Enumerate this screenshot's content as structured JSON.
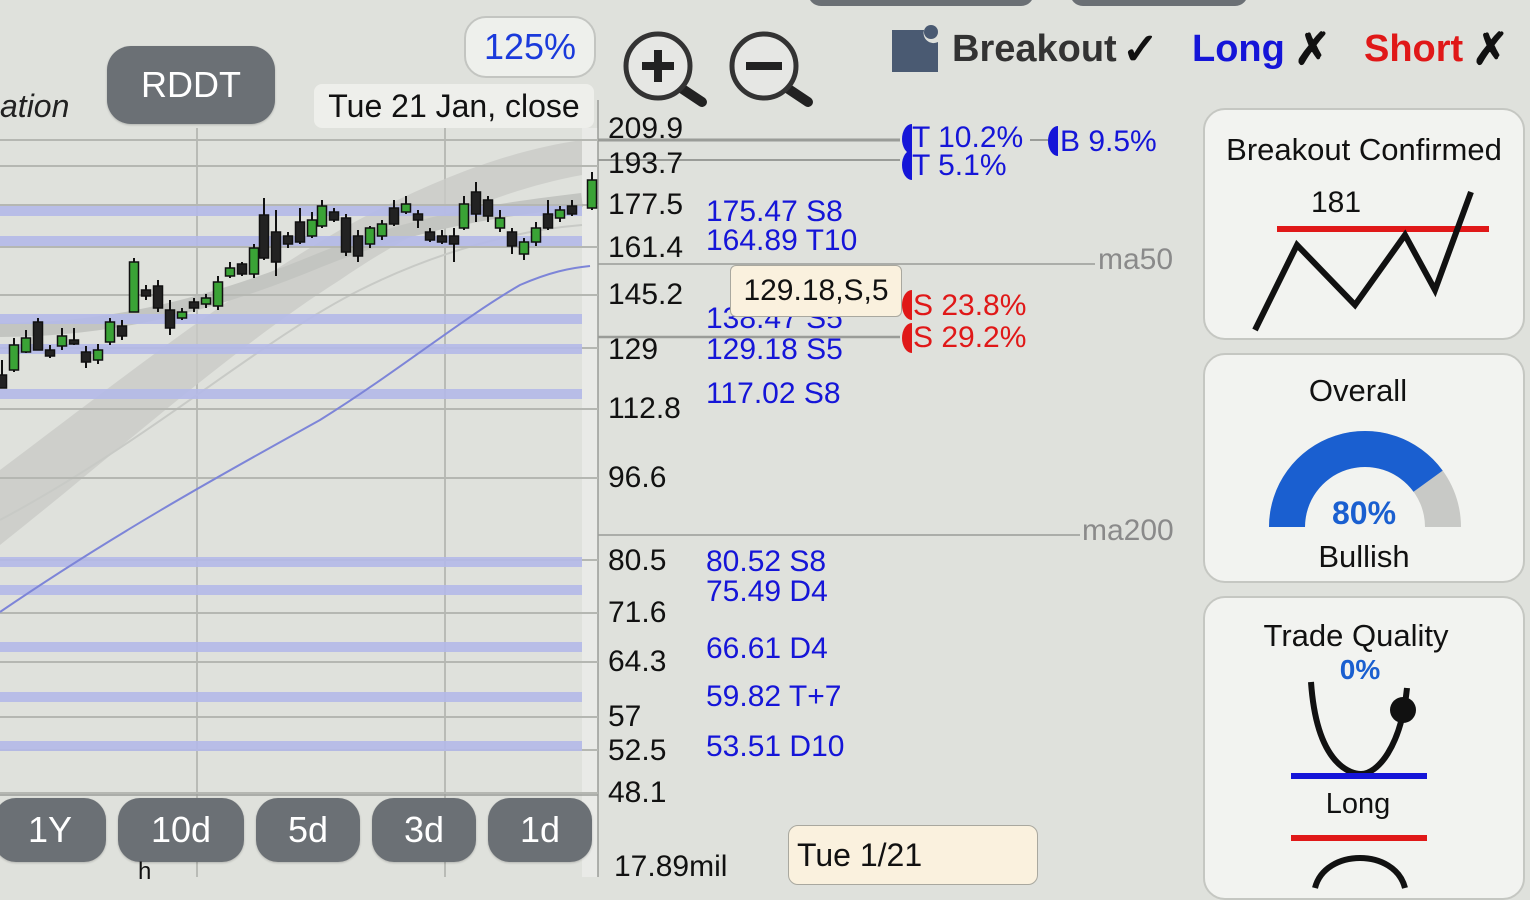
{
  "header": {
    "title_fragment": "ation",
    "ticker": "RDDT",
    "zoom": "125%",
    "date_label": "Tue 21 Jan, close",
    "zoom_in_icon": "zoom-in-icon",
    "zoom_out_icon": "zoom-out-icon"
  },
  "signals": {
    "breakout_label": "Breakout",
    "breakout_mark": "✓",
    "long_label": "Long",
    "long_mark": "✗",
    "short_label": "Short",
    "short_mark": "✗",
    "colors": {
      "breakout": "#333333",
      "long": "#1515d8",
      "short": "#e01818"
    }
  },
  "price_axis": [
    "209.9",
    "193.7",
    "177.5",
    "161.4",
    "145.2",
    "129",
    "112.8",
    "96.6",
    "80.5",
    "71.6",
    "64.3",
    "57",
    "52.5",
    "48.1"
  ],
  "volume_label": "17.89mil",
  "levels": [
    {
      "value": "175.47",
      "tag": "S8"
    },
    {
      "value": "164.89",
      "tag": "T10"
    },
    {
      "value": "138.47",
      "tag": "S5"
    },
    {
      "value": "129.18",
      "tag": "S5"
    },
    {
      "value": "117.02",
      "tag": "S8"
    },
    {
      "value": "80.52",
      "tag": "S8"
    },
    {
      "value": "75.49",
      "tag": "D4"
    },
    {
      "value": "66.61",
      "tag": "D4"
    },
    {
      "value": "59.82",
      "tag": "T+7"
    },
    {
      "value": "53.51",
      "tag": "D10"
    }
  ],
  "targets": {
    "t1": "T 10.2%",
    "b1": "B 9.5%",
    "t2": "T 5.1%",
    "s1": "S 23.8%",
    "s2": "S 29.2%"
  },
  "tooltip": "129.18,S,5",
  "ma_labels": {
    "ma50": "ma50",
    "ma200": "ma200"
  },
  "timeframes": [
    "1Y",
    "10d",
    "5d",
    "3d",
    "1d"
  ],
  "bottom_fragment": "h",
  "date_box": "Tue 1/21",
  "cards": {
    "breakout": {
      "title": "Breakout Confirmed",
      "value": "181"
    },
    "overall": {
      "title": "Overall",
      "percent": "80%",
      "label": "Bullish",
      "fraction": 0.8
    },
    "trade_quality": {
      "title": "Trade Quality",
      "percent": "0%",
      "label": "Long"
    }
  }
}
